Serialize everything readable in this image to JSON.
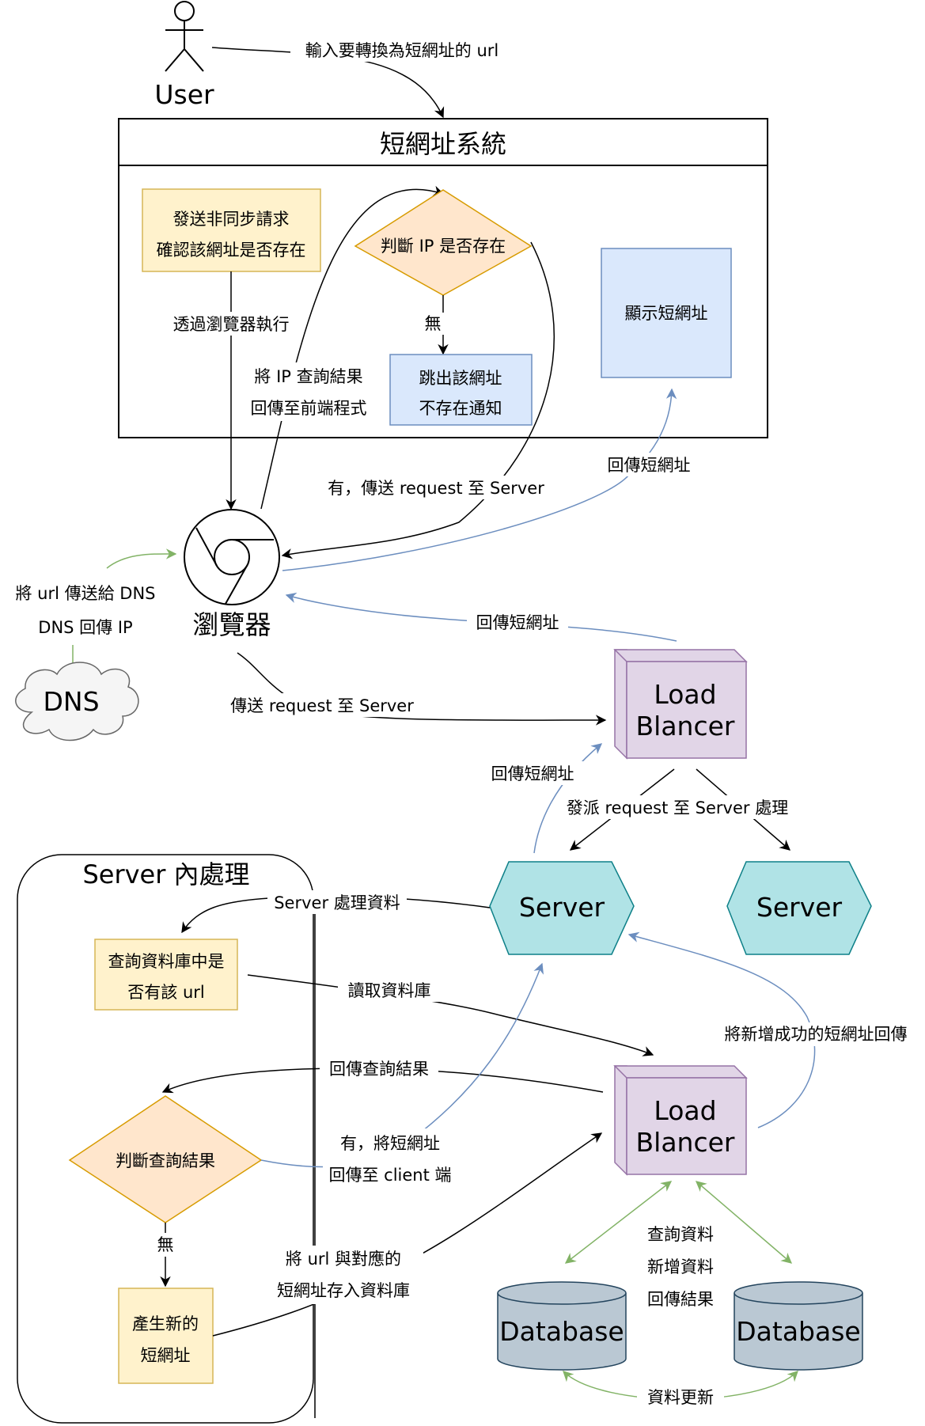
{
  "user": {
    "label": "User"
  },
  "user_to_system": "輸入要轉換為短網址的 url",
  "system": {
    "title": "短網址系統",
    "async_request": [
      "發送非同步請求",
      "確認該網址是否存在"
    ],
    "via_browser": "透過瀏覽器執行",
    "decision_ip": "判斷 IP 是否存在",
    "no_label": "無",
    "not_exist_notice": [
      "跳出該網址",
      "不存在通知"
    ],
    "show_short_url": "顯示短網址"
  },
  "ip_result_return": [
    "將 IP 查詢結果",
    "回傳至前端程式"
  ],
  "yes_send_request": "有，傳送 request 至 Server",
  "return_short_url": "回傳短網址",
  "browser": {
    "label": "瀏覽器"
  },
  "dns": {
    "label": "DNS",
    "send_to_dns": "將 url 傳送給 DNS",
    "dns_returns_ip": "DNS 回傳 IP"
  },
  "browser_send_request": "傳送 request 至 Server",
  "load_balancer": {
    "label": [
      "Load",
      "Blancer"
    ]
  },
  "dispatch_request": "發派 request 至 Server 處理",
  "server_label": "Server",
  "server_internal": {
    "title": "Server 內處理",
    "server_process_data": "Server 處理資料",
    "query_db": [
      "查詢資料庫中是",
      "否有該 url"
    ],
    "read_db": "讀取資料庫",
    "return_query_result": "回傳查詢結果",
    "decision_query": "判斷查詢結果",
    "yes_return": [
      "有，將短網址",
      "回傳至 client 端"
    ],
    "no_label": "無",
    "generate_new": [
      "產生新的",
      "短網址"
    ],
    "store_to_db": [
      "將 url 與對應的",
      "短網址存入資料庫"
    ]
  },
  "return_new_short_url": "將新增成功的短網址回傳",
  "db_ops": [
    "查詢資料",
    "新增資料",
    "回傳結果"
  ],
  "database_label": "Database",
  "data_update": "資料更新",
  "colors": {
    "yellow_fill": "#fff2cc",
    "yellow_stroke": "#d6b656",
    "blue_fill": "#dae8fc",
    "blue_stroke": "#6c8ebf",
    "orange_fill": "#ffe6cc",
    "orange_stroke": "#d79b00",
    "purple_fill": "#e1d5e7",
    "purple_stroke": "#9673a6",
    "teal_fill": "#b0e3e6",
    "teal_stroke": "#0e8088",
    "gray_fill": "#bac8d3",
    "gray_stroke": "#23445d",
    "green_line": "#82b366",
    "blue_line": "#6c8ebf"
  }
}
